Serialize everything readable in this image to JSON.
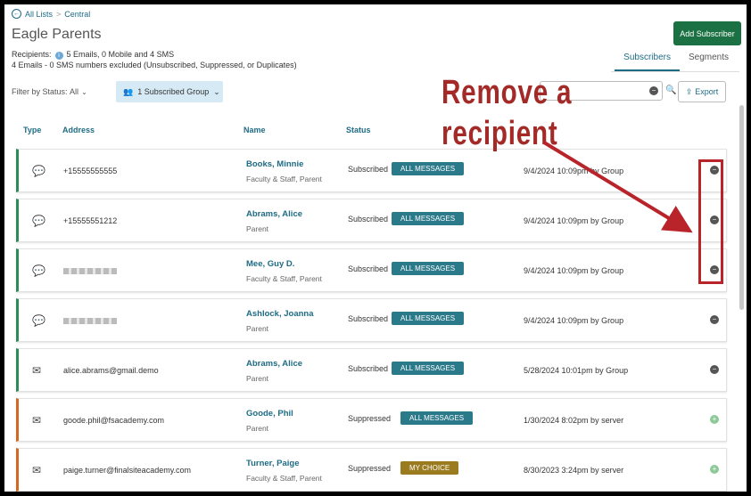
{
  "breadcrumb": {
    "back_icon": "arrow-left-circle-icon",
    "all_lists": "All Lists",
    "separator": ">",
    "current": "Central"
  },
  "page_title": "Eagle Parents",
  "recipients": {
    "label": "Recipients:",
    "summary": "5 Emails, 0 Mobile and 4 SMS",
    "excluded": "4 Emails - 0 SMS numbers excluded (Unsubscribed, Suppressed, or Duplicates)"
  },
  "add_subscriber_label": "Add Subscriber",
  "tabs": [
    {
      "label": "Subscribers",
      "active": true
    },
    {
      "label": "Segments",
      "active": false
    }
  ],
  "filter": {
    "label": "Filter by Status:",
    "value": "All"
  },
  "group_chip": "1 Subscribed Group",
  "export_label": "Export",
  "columns": {
    "type": "Type",
    "address": "Address",
    "name": "Name",
    "status": "Status"
  },
  "rows": [
    {
      "type": "sms",
      "address": "+15555555555",
      "name": "Books, Minnie",
      "role": "Faculty & Staff, Parent",
      "status": "Subscribed",
      "badge": "ALL MESSAGES",
      "date": "9/4/2024 10:09pm by Group",
      "action": "remove"
    },
    {
      "type": "sms",
      "address": "+15555551212",
      "name": "Abrams, Alice",
      "role": "Parent",
      "status": "Subscribed",
      "badge": "ALL MESSAGES",
      "date": "9/4/2024 10:09pm by Group",
      "action": "remove"
    },
    {
      "type": "sms",
      "address": "",
      "name": "Mee, Guy D.",
      "role": "Faculty & Staff, Parent",
      "status": "Subscribed",
      "badge": "ALL MESSAGES",
      "date": "9/4/2024 10:09pm by Group",
      "action": "remove"
    },
    {
      "type": "sms",
      "address": "",
      "name": "Ashlock, Joanna",
      "role": "Parent",
      "status": "Subscribed",
      "badge": "ALL MESSAGES",
      "date": "9/4/2024 10:09pm by Group",
      "action": "remove"
    },
    {
      "type": "email",
      "address": "alice.abrams@gmail.demo",
      "name": "Abrams, Alice",
      "role": "Parent",
      "status": "Subscribed",
      "badge": "ALL MESSAGES",
      "date": "5/28/2024 10:01pm by Group",
      "action": "remove"
    },
    {
      "type": "email",
      "address": "goode.phil@fsacademy.com",
      "name": "Goode, Phil",
      "role": "Parent",
      "status": "Suppressed",
      "badge": "ALL MESSAGES",
      "date": "1/30/2024 8:02pm by server",
      "action": "add"
    },
    {
      "type": "email",
      "address": "paige.turner@finalsiteacademy.com",
      "name": "Turner, Paige",
      "role": "Faculty & Staff, Parent",
      "status": "Suppressed",
      "badge": "MY CHOICE",
      "date": "8/30/2023 3:24pm by server",
      "action": "add"
    }
  ],
  "annotation": {
    "line1": "Remove a",
    "line2": "recipient"
  },
  "colors": {
    "brand": "#1e6b85",
    "add_button": "#1b7143",
    "badge": "#2b7a8a",
    "choice_badge": "#9a7b1f",
    "subscribed_bar": "#2e8b57",
    "suppressed_bar": "#d2691e",
    "annotation": "#a42a28"
  }
}
